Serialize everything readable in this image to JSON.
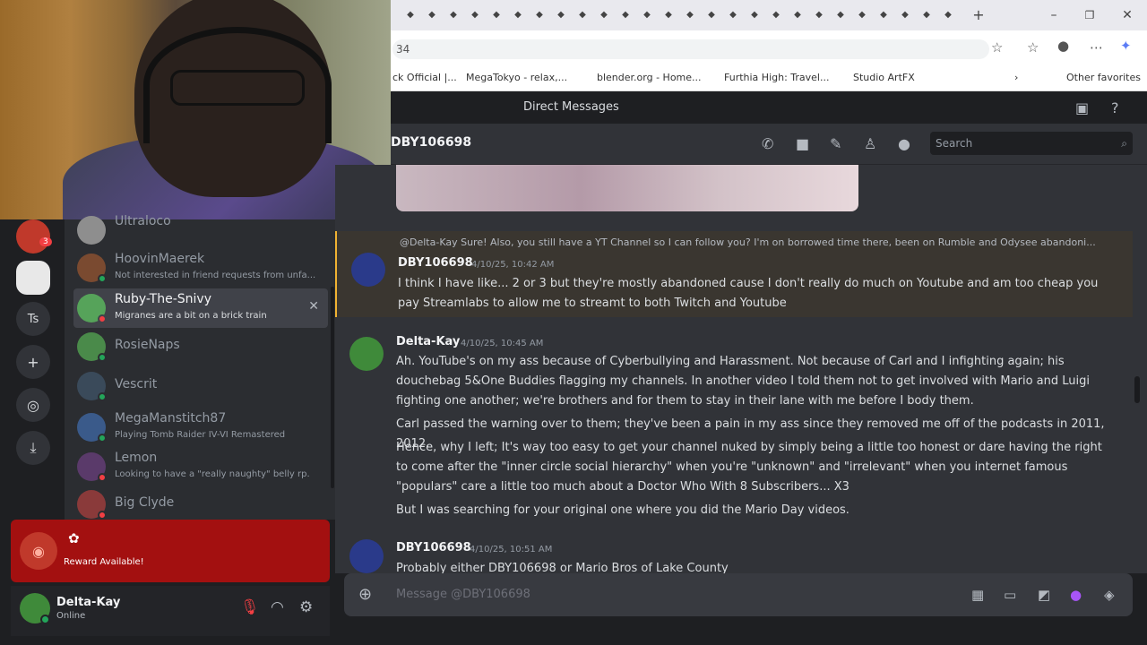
{
  "browser": {
    "url_fragment": "34",
    "bookmarks": [
      "ck Official |...",
      "MegaTokyo - relax,...",
      "blender.org - Home...",
      "Furthia High: Travel...",
      "Studio ArtFX",
      "Other favorites"
    ]
  },
  "app": {
    "title": "Direct Messages",
    "channel_name": "DBY106698",
    "search_placeholder": "Search"
  },
  "sidebar": {
    "server_label": "Ts",
    "server_badge": "3",
    "dms": [
      {
        "name": "Ultraloco",
        "sub": "",
        "color": "#8e8e8e"
      },
      {
        "name": "HoovinMaerek",
        "sub": "Not interested in friend requests from unfa...",
        "color": "#7a4a30"
      },
      {
        "name": "Ruby-The-Snivy",
        "sub": "Migranes are a bit on a brick train",
        "color": "#56a35a"
      },
      {
        "name": "RosieNaps",
        "sub": "",
        "color": "#4a8a4a"
      },
      {
        "name": "Vescrit",
        "sub": "",
        "color": "#3a4a5a"
      },
      {
        "name": "MegaManstitch87",
        "sub": "Playing Tomb Raider IV-VI Remastered",
        "color": "#3a5a8a"
      },
      {
        "name": "Lemon",
        "sub": "Looking to have a \"really naughty\" belly rp.",
        "color": "#5a3a6a"
      },
      {
        "name": "Big Clyde",
        "sub": "",
        "color": "#8a3a3a"
      }
    ],
    "reward": "Reward Available!"
  },
  "user": {
    "name": "Delta-Kay",
    "status": "Online"
  },
  "messages": [
    {
      "reply": "@Delta-Kay Sure! Also, you still have a YT Channel so I can follow you? I'm on borrowed time there, been on Rumble and Odysee abandoni...",
      "author": "DBY106698",
      "time": "4/10/25, 10:42 AM",
      "lines": [
        "I think I have like... 2 or 3 but they're mostly abandoned cause I don't really do much on Youtube and am too cheap you pay Streamlabs to allow me to streamt to both Twitch and Youtube"
      ]
    },
    {
      "author": "Delta-Kay",
      "time": "4/10/25, 10:45 AM",
      "lines": [
        "Ah. YouTube's on my ass because of Cyberbullying and Harassment. Not because of Carl and I infighting again; his douchebag 5&One Buddies flagging my channels. In another video I told them not to get involved with Mario and Luigi fighting one another; we're brothers and for them to stay in their lane with me before I body them.",
        "Carl passed the warning over to them; they've been a pain in my ass since they removed me off of the podcasts in 2011, 2012.",
        "Hence, why I left; It's way too easy to get your channel nuked by simply being a little too honest or dare having the right to come after the \"inner circle social hierarchy\" when you're \"unknown\" and \"irrelevant\" when you internet famous \"populars\" care a little too much about a Doctor Who With 8 Subscribers... X3",
        "But I was searching for your original one where you did the Mario Day videos."
      ]
    },
    {
      "author": "DBY106698",
      "time": "4/10/25, 10:51 AM",
      "lines": [
        "Probably either DBY106698 or Mario Bros of Lake County"
      ]
    }
  ],
  "composer": {
    "placeholder": "Message @DBY106698"
  }
}
